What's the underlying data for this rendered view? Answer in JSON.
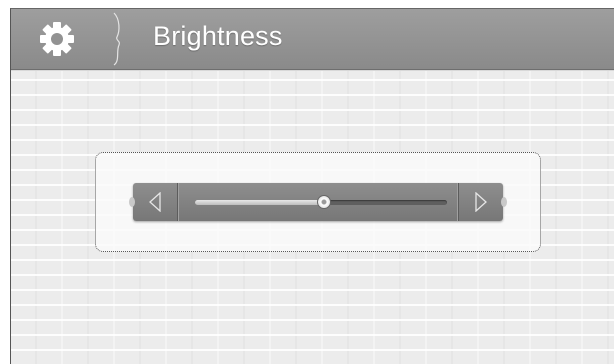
{
  "header": {
    "title": "Brightness",
    "settings_icon": "gear-icon",
    "divider_icon": "brace-divider-icon"
  },
  "brightness_slider": {
    "value_fraction": 0.51,
    "decrease_icon": "triangle-left-icon",
    "increase_icon": "triangle-right-icon"
  },
  "colors": {
    "header": "#959595",
    "background": "#efefef",
    "slider": "#858585",
    "text": "#ffffff"
  }
}
